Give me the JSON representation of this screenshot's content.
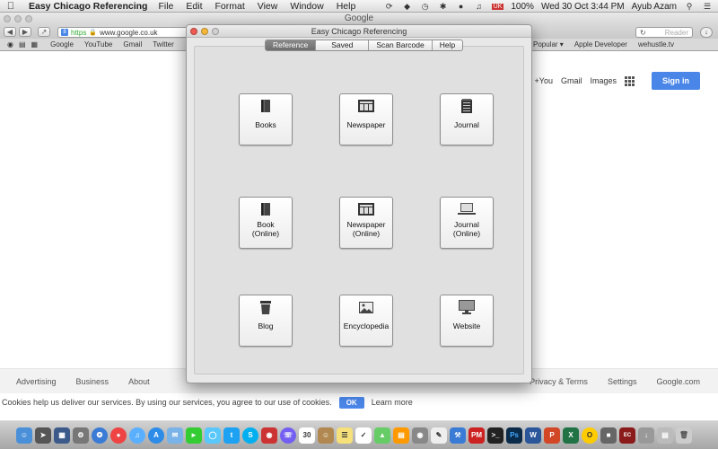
{
  "menubar": {
    "app_name": "Easy Chicago Referencing",
    "items": [
      "File",
      "Edit",
      "Format",
      "View",
      "Window",
      "Help"
    ],
    "language": "UK",
    "battery": "100%",
    "datetime": "Wed 30 Oct  3:44 PM",
    "user": "Ayub Azam"
  },
  "safari": {
    "title": "Google",
    "address_protocol": "https",
    "address": "www.google.co.uk",
    "reader_label": "Reader",
    "bookmarks": [
      "Google",
      "YouTube",
      "Gmail",
      "Twitter"
    ],
    "bookmarks_right": [
      "Popular ▾",
      "Apple Developer",
      "wehustle.tv"
    ]
  },
  "google": {
    "top_links": [
      "+You",
      "Gmail",
      "Images"
    ],
    "signin_label": "Sign in",
    "footer_left": [
      "Advertising",
      "Business",
      "About"
    ],
    "footer_right": [
      "Privacy & Terms",
      "Settings",
      "Google.com"
    ],
    "cookie_text": "Cookies help us deliver our services. By using our services, you agree to our use of cookies.",
    "cookie_ok": "OK",
    "cookie_learn": "Learn more"
  },
  "app_window": {
    "title": "Easy Chicago Referencing",
    "tabs": [
      {
        "label": "Reference",
        "active": true
      },
      {
        "label": "Saved",
        "active": false
      },
      {
        "label": "Scan Barcode",
        "active": false
      },
      {
        "label": "Help",
        "active": false
      }
    ],
    "tiles": [
      {
        "label": "Books",
        "icon": "book-icon"
      },
      {
        "label": "Newspaper",
        "icon": "newspaper-icon"
      },
      {
        "label": "Journal",
        "icon": "notepad-icon"
      },
      {
        "label": "Book\n(Online)",
        "icon": "book-icon"
      },
      {
        "label": "Newspaper\n(Online)",
        "icon": "newspaper-icon"
      },
      {
        "label": "Journal\n(Online)",
        "icon": "laptop-icon"
      },
      {
        "label": "Blog",
        "icon": "cup-icon"
      },
      {
        "label": "Encyclopedia",
        "icon": "picture-icon"
      },
      {
        "label": "Website",
        "icon": "monitor-icon"
      }
    ]
  },
  "dock": {
    "items": [
      "finder-icon",
      "launchpad-icon",
      "mission-control-icon",
      "system-prefs-icon",
      "safari-icon",
      "chrome-icon",
      "itunes-icon",
      "appstore-icon",
      "mail-icon",
      "facetime-icon",
      "messages-icon",
      "twitter-icon",
      "skype-icon",
      "photobooth-icon",
      "viber-icon",
      "calendar-icon",
      "contacts-icon",
      "notes-icon",
      "reminders-icon",
      "maps-icon",
      "ibooks-icon",
      "preview-icon",
      "pages-icon",
      "xcode-icon",
      "pm-icon",
      "terminal-icon",
      "photoshop-icon",
      "word-icon",
      "powerpoint-icon",
      "excel-icon",
      "app1-icon",
      "app2-icon",
      "easy-chicago-icon",
      "downloads-icon",
      "documents-icon",
      "trash-icon"
    ]
  }
}
